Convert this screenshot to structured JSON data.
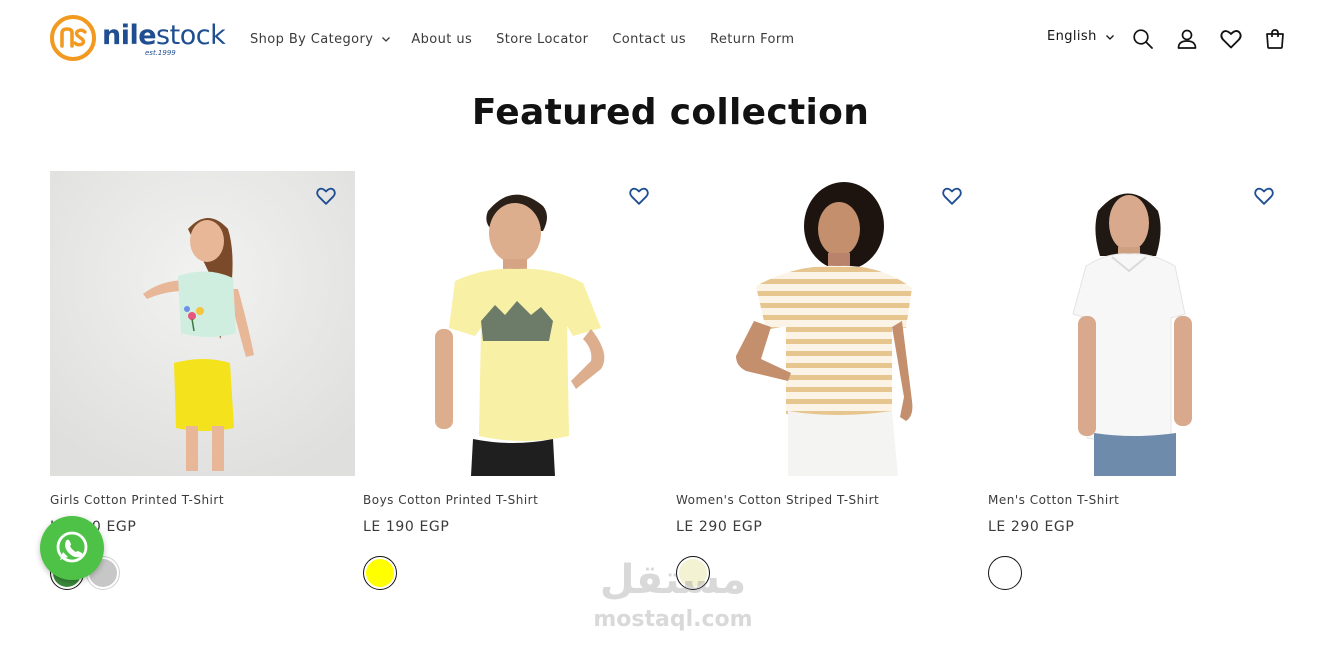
{
  "brand": {
    "name_part1": "nile",
    "name_part2": "stock",
    "established": "est.1999",
    "color": "#1f4e91",
    "accent": "#f29a1f"
  },
  "nav": {
    "items": [
      {
        "label": "Shop By Category",
        "has_dropdown": true
      },
      {
        "label": "About us"
      },
      {
        "label": "Store Locator"
      },
      {
        "label": "Contact us"
      },
      {
        "label": "Return Form"
      }
    ]
  },
  "header": {
    "language": "English",
    "icons": [
      "search-icon",
      "account-icon",
      "wishlist-icon",
      "cart-icon"
    ]
  },
  "section": {
    "title": "Featured collection"
  },
  "products": [
    {
      "name": "Girls Cotton Printed T-Shirt",
      "price": "LE 190 EGP",
      "swatches": [
        {
          "color": "#3a8a3a",
          "selected": true
        },
        {
          "color": "#c7c7c7",
          "selected": false
        }
      ]
    },
    {
      "name": "Boys Cotton Printed T-Shirt",
      "price": "LE 190 EGP",
      "swatches": [
        {
          "color": "#ffff00",
          "selected": true
        }
      ]
    },
    {
      "name": "Women's Cotton Striped T-Shirt",
      "price": "LE 290 EGP",
      "swatches": [
        {
          "color": "#f3f2d3",
          "selected": true
        }
      ]
    },
    {
      "name": "Men's Cotton T-Shirt",
      "price": "LE 290 EGP",
      "swatches": [
        {
          "color": "#ffffff",
          "selected": true
        }
      ]
    }
  ],
  "whatsapp": {
    "icon": "whatsapp-icon",
    "color": "#4dc247"
  },
  "watermark": {
    "arabic": "مستقل",
    "latin": "mostaql.com"
  }
}
